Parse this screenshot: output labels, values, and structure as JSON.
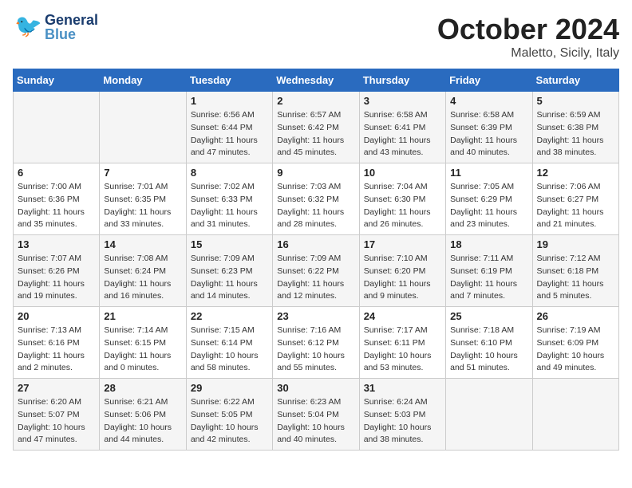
{
  "header": {
    "logo_general": "General",
    "logo_blue": "Blue",
    "month": "October 2024",
    "location": "Maletto, Sicily, Italy"
  },
  "columns": [
    "Sunday",
    "Monday",
    "Tuesday",
    "Wednesday",
    "Thursday",
    "Friday",
    "Saturday"
  ],
  "weeks": [
    {
      "days": [
        {
          "num": "",
          "info": ""
        },
        {
          "num": "",
          "info": ""
        },
        {
          "num": "1",
          "info": "Sunrise: 6:56 AM\nSunset: 6:44 PM\nDaylight: 11 hours\nand 47 minutes."
        },
        {
          "num": "2",
          "info": "Sunrise: 6:57 AM\nSunset: 6:42 PM\nDaylight: 11 hours\nand 45 minutes."
        },
        {
          "num": "3",
          "info": "Sunrise: 6:58 AM\nSunset: 6:41 PM\nDaylight: 11 hours\nand 43 minutes."
        },
        {
          "num": "4",
          "info": "Sunrise: 6:58 AM\nSunset: 6:39 PM\nDaylight: 11 hours\nand 40 minutes."
        },
        {
          "num": "5",
          "info": "Sunrise: 6:59 AM\nSunset: 6:38 PM\nDaylight: 11 hours\nand 38 minutes."
        }
      ]
    },
    {
      "days": [
        {
          "num": "6",
          "info": "Sunrise: 7:00 AM\nSunset: 6:36 PM\nDaylight: 11 hours\nand 35 minutes."
        },
        {
          "num": "7",
          "info": "Sunrise: 7:01 AM\nSunset: 6:35 PM\nDaylight: 11 hours\nand 33 minutes."
        },
        {
          "num": "8",
          "info": "Sunrise: 7:02 AM\nSunset: 6:33 PM\nDaylight: 11 hours\nand 31 minutes."
        },
        {
          "num": "9",
          "info": "Sunrise: 7:03 AM\nSunset: 6:32 PM\nDaylight: 11 hours\nand 28 minutes."
        },
        {
          "num": "10",
          "info": "Sunrise: 7:04 AM\nSunset: 6:30 PM\nDaylight: 11 hours\nand 26 minutes."
        },
        {
          "num": "11",
          "info": "Sunrise: 7:05 AM\nSunset: 6:29 PM\nDaylight: 11 hours\nand 23 minutes."
        },
        {
          "num": "12",
          "info": "Sunrise: 7:06 AM\nSunset: 6:27 PM\nDaylight: 11 hours\nand 21 minutes."
        }
      ]
    },
    {
      "days": [
        {
          "num": "13",
          "info": "Sunrise: 7:07 AM\nSunset: 6:26 PM\nDaylight: 11 hours\nand 19 minutes."
        },
        {
          "num": "14",
          "info": "Sunrise: 7:08 AM\nSunset: 6:24 PM\nDaylight: 11 hours\nand 16 minutes."
        },
        {
          "num": "15",
          "info": "Sunrise: 7:09 AM\nSunset: 6:23 PM\nDaylight: 11 hours\nand 14 minutes."
        },
        {
          "num": "16",
          "info": "Sunrise: 7:09 AM\nSunset: 6:22 PM\nDaylight: 11 hours\nand 12 minutes."
        },
        {
          "num": "17",
          "info": "Sunrise: 7:10 AM\nSunset: 6:20 PM\nDaylight: 11 hours\nand 9 minutes."
        },
        {
          "num": "18",
          "info": "Sunrise: 7:11 AM\nSunset: 6:19 PM\nDaylight: 11 hours\nand 7 minutes."
        },
        {
          "num": "19",
          "info": "Sunrise: 7:12 AM\nSunset: 6:18 PM\nDaylight: 11 hours\nand 5 minutes."
        }
      ]
    },
    {
      "days": [
        {
          "num": "20",
          "info": "Sunrise: 7:13 AM\nSunset: 6:16 PM\nDaylight: 11 hours\nand 2 minutes."
        },
        {
          "num": "21",
          "info": "Sunrise: 7:14 AM\nSunset: 6:15 PM\nDaylight: 11 hours\nand 0 minutes."
        },
        {
          "num": "22",
          "info": "Sunrise: 7:15 AM\nSunset: 6:14 PM\nDaylight: 10 hours\nand 58 minutes."
        },
        {
          "num": "23",
          "info": "Sunrise: 7:16 AM\nSunset: 6:12 PM\nDaylight: 10 hours\nand 55 minutes."
        },
        {
          "num": "24",
          "info": "Sunrise: 7:17 AM\nSunset: 6:11 PM\nDaylight: 10 hours\nand 53 minutes."
        },
        {
          "num": "25",
          "info": "Sunrise: 7:18 AM\nSunset: 6:10 PM\nDaylight: 10 hours\nand 51 minutes."
        },
        {
          "num": "26",
          "info": "Sunrise: 7:19 AM\nSunset: 6:09 PM\nDaylight: 10 hours\nand 49 minutes."
        }
      ]
    },
    {
      "days": [
        {
          "num": "27",
          "info": "Sunrise: 6:20 AM\nSunset: 5:07 PM\nDaylight: 10 hours\nand 47 minutes."
        },
        {
          "num": "28",
          "info": "Sunrise: 6:21 AM\nSunset: 5:06 PM\nDaylight: 10 hours\nand 44 minutes."
        },
        {
          "num": "29",
          "info": "Sunrise: 6:22 AM\nSunset: 5:05 PM\nDaylight: 10 hours\nand 42 minutes."
        },
        {
          "num": "30",
          "info": "Sunrise: 6:23 AM\nSunset: 5:04 PM\nDaylight: 10 hours\nand 40 minutes."
        },
        {
          "num": "31",
          "info": "Sunrise: 6:24 AM\nSunset: 5:03 PM\nDaylight: 10 hours\nand 38 minutes."
        },
        {
          "num": "",
          "info": ""
        },
        {
          "num": "",
          "info": ""
        }
      ]
    }
  ]
}
